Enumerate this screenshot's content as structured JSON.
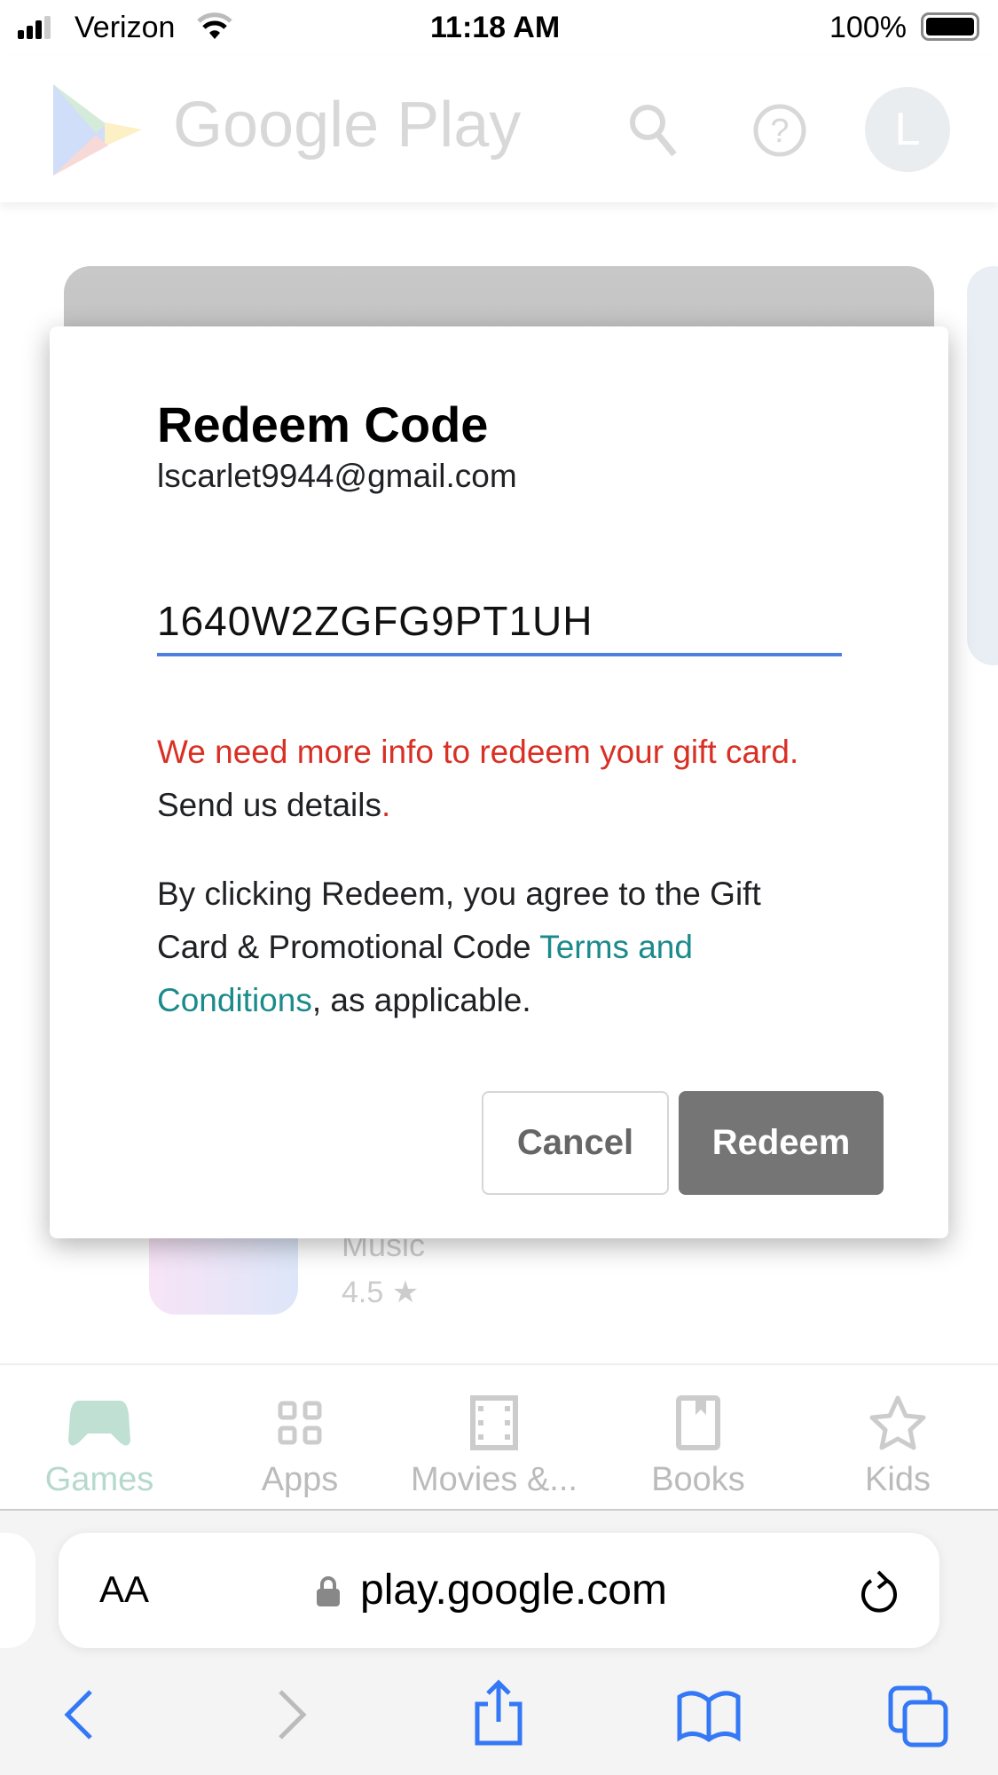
{
  "status_bar": {
    "carrier": "Verizon",
    "time": "11:18 AM",
    "battery": "100%"
  },
  "header": {
    "logo_text": "Google Play",
    "avatar_letter": "L"
  },
  "background": {
    "app_category": "Music",
    "app_rating": "4.5 ★"
  },
  "dialog": {
    "title": "Redeem Code",
    "email": "lscarlet9944@gmail.com",
    "code_value": "1640W2ZGFG9PT1UH",
    "error_text": "We need more info to redeem your gift card.",
    "error_link": "Send us details",
    "error_period": ".",
    "terms_prefix": "By clicking Redeem, you agree to the Gift Card & Promotional Code ",
    "terms_link": "Terms and Conditions",
    "terms_suffix": ", as applicable.",
    "cancel_label": "Cancel",
    "redeem_label": "Redeem",
    "colors": {
      "error": "#d93025",
      "link": "#1a8a8a",
      "underline": "#4d7fe0",
      "redeem_button": "#757575"
    }
  },
  "bottom_nav": {
    "items": [
      {
        "label": "Games",
        "icon": "gamepad-icon",
        "active": true
      },
      {
        "label": "Apps",
        "icon": "apps-grid-icon"
      },
      {
        "label": "Movies &...",
        "icon": "film-icon"
      },
      {
        "label": "Books",
        "icon": "book-icon"
      },
      {
        "label": "Kids",
        "icon": "star-icon"
      }
    ]
  },
  "safari": {
    "text_size": "AA",
    "url": "play.google.com"
  }
}
